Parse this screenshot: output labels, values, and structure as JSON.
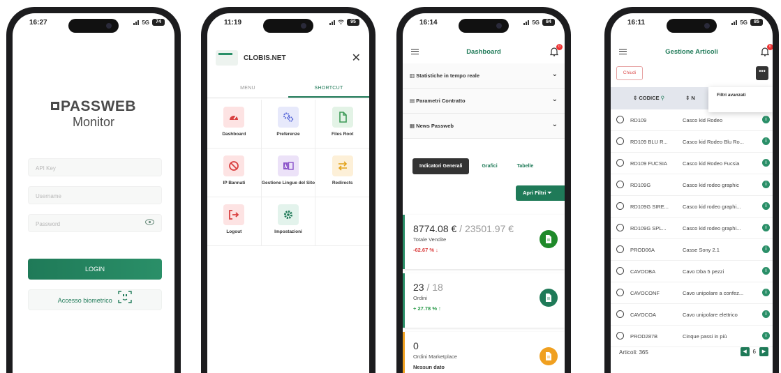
{
  "accent_color": "#1f7a58",
  "phones": {
    "login": {
      "status": {
        "time": "16:27",
        "network": "5G",
        "battery": "74"
      },
      "logo_line1": "PASSWEB",
      "logo_line2": "Monitor",
      "api_key_placeholder": "API Key",
      "username_placeholder": "Username",
      "password_placeholder": "Password",
      "login_label": "LOGIN",
      "biometric_label": "Accesso biometrico"
    },
    "menu": {
      "status": {
        "time": "11:19",
        "battery": "95"
      },
      "brand": "CLOBIS.NET",
      "tabs": [
        "MENU",
        "SHORTCUT"
      ],
      "items": [
        {
          "label": "Dashboard",
          "icon": "speedometer-icon",
          "bg": "#fde3e3",
          "fg": "#d94040"
        },
        {
          "label": "Preferenze",
          "icon": "cogs-icon",
          "bg": "#e7e9fb",
          "fg": "#5a6ad9"
        },
        {
          "label": "Files Root",
          "icon": "file-icon",
          "bg": "#e3f3e6",
          "fg": "#3c9a57"
        },
        {
          "label": "IP Bannati",
          "icon": "ban-icon",
          "bg": "#fde3e3",
          "fg": "#d94040"
        },
        {
          "label": "Gestione Lingue del Sito",
          "icon": "language-icon",
          "bg": "#ece2f8",
          "fg": "#8a52c9"
        },
        {
          "label": "Redirects",
          "icon": "arrows-icon",
          "bg": "#fdf0d8",
          "fg": "#e2a21a"
        },
        {
          "label": "Logout",
          "icon": "logout-icon",
          "bg": "#fde3e3",
          "fg": "#d94040"
        },
        {
          "label": "Impostazioni",
          "icon": "gear-icon",
          "bg": "#e3f3ec",
          "fg": "#1f7a58"
        }
      ]
    },
    "dashboard": {
      "status": {
        "time": "16:14",
        "network": "5G",
        "battery": "84"
      },
      "title": "Dashboard",
      "notif_count": "0",
      "sections": [
        "Statistiche in tempo reale",
        "Parametri Contratto",
        "News Passweb"
      ],
      "segments": [
        "Indicatori Generali",
        "Grafici",
        "Tabelle"
      ],
      "filter_label": "Apri Filtri",
      "cards": [
        {
          "value": "8774.08 €",
          "compare": " / 23501.97 €",
          "label": "Totale Vendite",
          "pct": "-62.67 % ↓",
          "pct_color": "#d93a3a",
          "fab_color": "#1f8a2a",
          "border": "#2a8f68"
        },
        {
          "value": "23",
          "compare": " / 18",
          "label": "Ordini",
          "pct": "+ 27.78 % ↑",
          "pct_color": "#2a9a4a",
          "fab_color": "#1f7a58",
          "border": "#2a8f68"
        },
        {
          "value": "0",
          "compare": "",
          "label": "Ordini Marketplace",
          "pct": "Nessun dato",
          "pct_color": "#333333",
          "fab_color": "#f0a020",
          "border": "#f0a020"
        }
      ]
    },
    "articoli": {
      "status": {
        "time": "16:11",
        "network": "5G",
        "battery": "85"
      },
      "title": "Gestione Articoli",
      "notif_count": "0",
      "close_label": "Chiudi",
      "more_label": "•••",
      "popup_label": "Filtri avanzati",
      "col_code": "CODICE",
      "col_desc": "N",
      "rows": [
        {
          "code": "RD109",
          "desc": "Casco kid Rodeo"
        },
        {
          "code": "RD109 BLU R...",
          "desc": "Casco kid Rodeo Blu Ro..."
        },
        {
          "code": "RD109 FUCSIA",
          "desc": "Casco kid Rodeo Fucsia"
        },
        {
          "code": "RD109G",
          "desc": "Casco kid rodeo graphic"
        },
        {
          "code": "RD109G SIRE...",
          "desc": "Casco kid rodeo graphi..."
        },
        {
          "code": "RD109G SPL...",
          "desc": "Casco kid rodeo graphi..."
        },
        {
          "code": "PROD06A",
          "desc": "Casse Sony 2.1"
        },
        {
          "code": "CAVODBA",
          "desc": "Cavo Dba 5 pezzi"
        },
        {
          "code": "CAVOCONF",
          "desc": "Cavo unipolare a confez..."
        },
        {
          "code": "CAVOCOA",
          "desc": "Cavo unipolare elettrico"
        },
        {
          "code": "PROD287B",
          "desc": "Cinque passi in più"
        }
      ],
      "count_label": "Articoli: 365",
      "page": "6"
    }
  }
}
